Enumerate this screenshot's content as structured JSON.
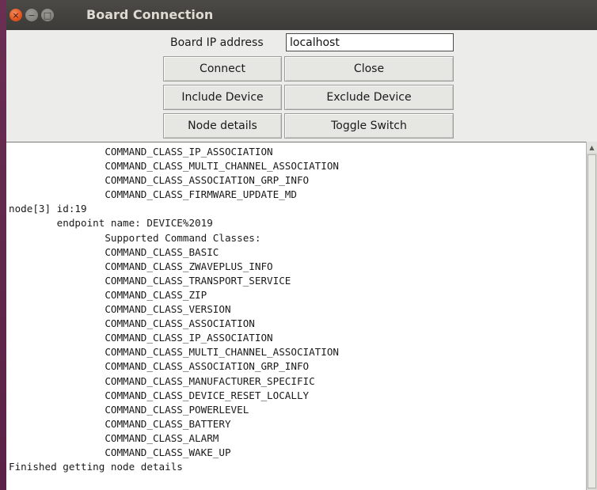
{
  "window": {
    "title": "Board Connection",
    "controls": {
      "close_icon": "×",
      "minimize_icon": "−",
      "maximize_icon": "□"
    }
  },
  "form": {
    "ip_label": "Board IP address",
    "ip_value": "localhost"
  },
  "buttons": {
    "connect": "Connect",
    "close": "Close",
    "include_device": "Include Device",
    "exclude_device": "Exclude Device",
    "node_details": "Node details",
    "toggle_switch": "Toggle Switch"
  },
  "output": {
    "lines": [
      "\t\tCOMMAND_CLASS_IP_ASSOCIATION",
      "\t\tCOMMAND_CLASS_MULTI_CHANNEL_ASSOCIATION",
      "\t\tCOMMAND_CLASS_ASSOCIATION_GRP_INFO",
      "\t\tCOMMAND_CLASS_FIRMWARE_UPDATE_MD",
      "node[3] id:19",
      "\tendpoint name: DEVICE%2019",
      "\t\tSupported Command Classes:",
      "\t\tCOMMAND_CLASS_BASIC",
      "\t\tCOMMAND_CLASS_ZWAVEPLUS_INFO",
      "\t\tCOMMAND_CLASS_TRANSPORT_SERVICE",
      "\t\tCOMMAND_CLASS_ZIP",
      "\t\tCOMMAND_CLASS_VERSION",
      "\t\tCOMMAND_CLASS_ASSOCIATION",
      "\t\tCOMMAND_CLASS_IP_ASSOCIATION",
      "\t\tCOMMAND_CLASS_MULTI_CHANNEL_ASSOCIATION",
      "\t\tCOMMAND_CLASS_ASSOCIATION_GRP_INFO",
      "\t\tCOMMAND_CLASS_MANUFACTURER_SPECIFIC",
      "\t\tCOMMAND_CLASS_DEVICE_RESET_LOCALLY",
      "\t\tCOMMAND_CLASS_POWERLEVEL",
      "\t\tCOMMAND_CLASS_BATTERY",
      "\t\tCOMMAND_CLASS_ALARM",
      "\t\tCOMMAND_CLASS_WAKE_UP",
      "Finished getting node details"
    ]
  },
  "scrollbar": {
    "up_icon": "▲"
  },
  "colors": {
    "titlebar": "#3c3b37",
    "window_bg": "#ececea",
    "close_button": "#e2531d"
  }
}
